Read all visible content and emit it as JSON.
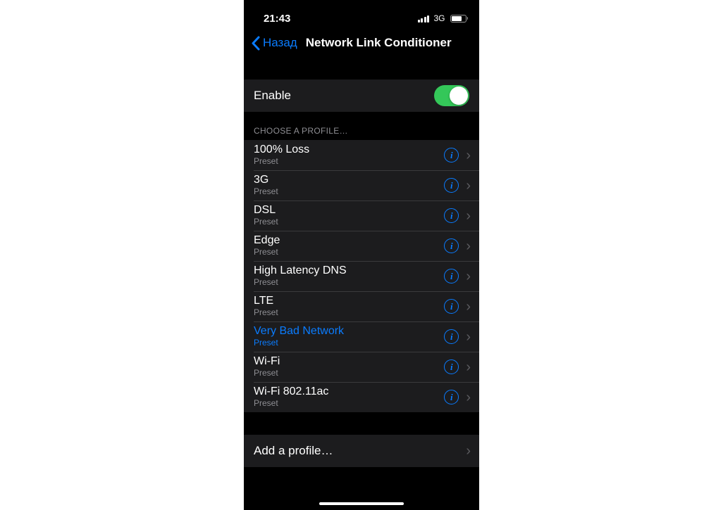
{
  "status": {
    "time": "21:43",
    "network": "3G"
  },
  "nav": {
    "back_label": "Назад",
    "title": "Network Link Conditioner"
  },
  "enable": {
    "label": "Enable",
    "on": true
  },
  "section_header": "Choose a profile…",
  "profiles": [
    {
      "title": "100% Loss",
      "subtitle": "Preset",
      "selected": false
    },
    {
      "title": "3G",
      "subtitle": "Preset",
      "selected": false
    },
    {
      "title": "DSL",
      "subtitle": "Preset",
      "selected": false
    },
    {
      "title": "Edge",
      "subtitle": "Preset",
      "selected": false
    },
    {
      "title": "High Latency DNS",
      "subtitle": "Preset",
      "selected": false
    },
    {
      "title": "LTE",
      "subtitle": "Preset",
      "selected": false
    },
    {
      "title": "Very Bad Network",
      "subtitle": "Preset",
      "selected": true
    },
    {
      "title": "Wi-Fi",
      "subtitle": "Preset",
      "selected": false
    },
    {
      "title": "Wi-Fi 802.11ac",
      "subtitle": "Preset",
      "selected": false
    }
  ],
  "add_profile_label": "Add a profile…"
}
